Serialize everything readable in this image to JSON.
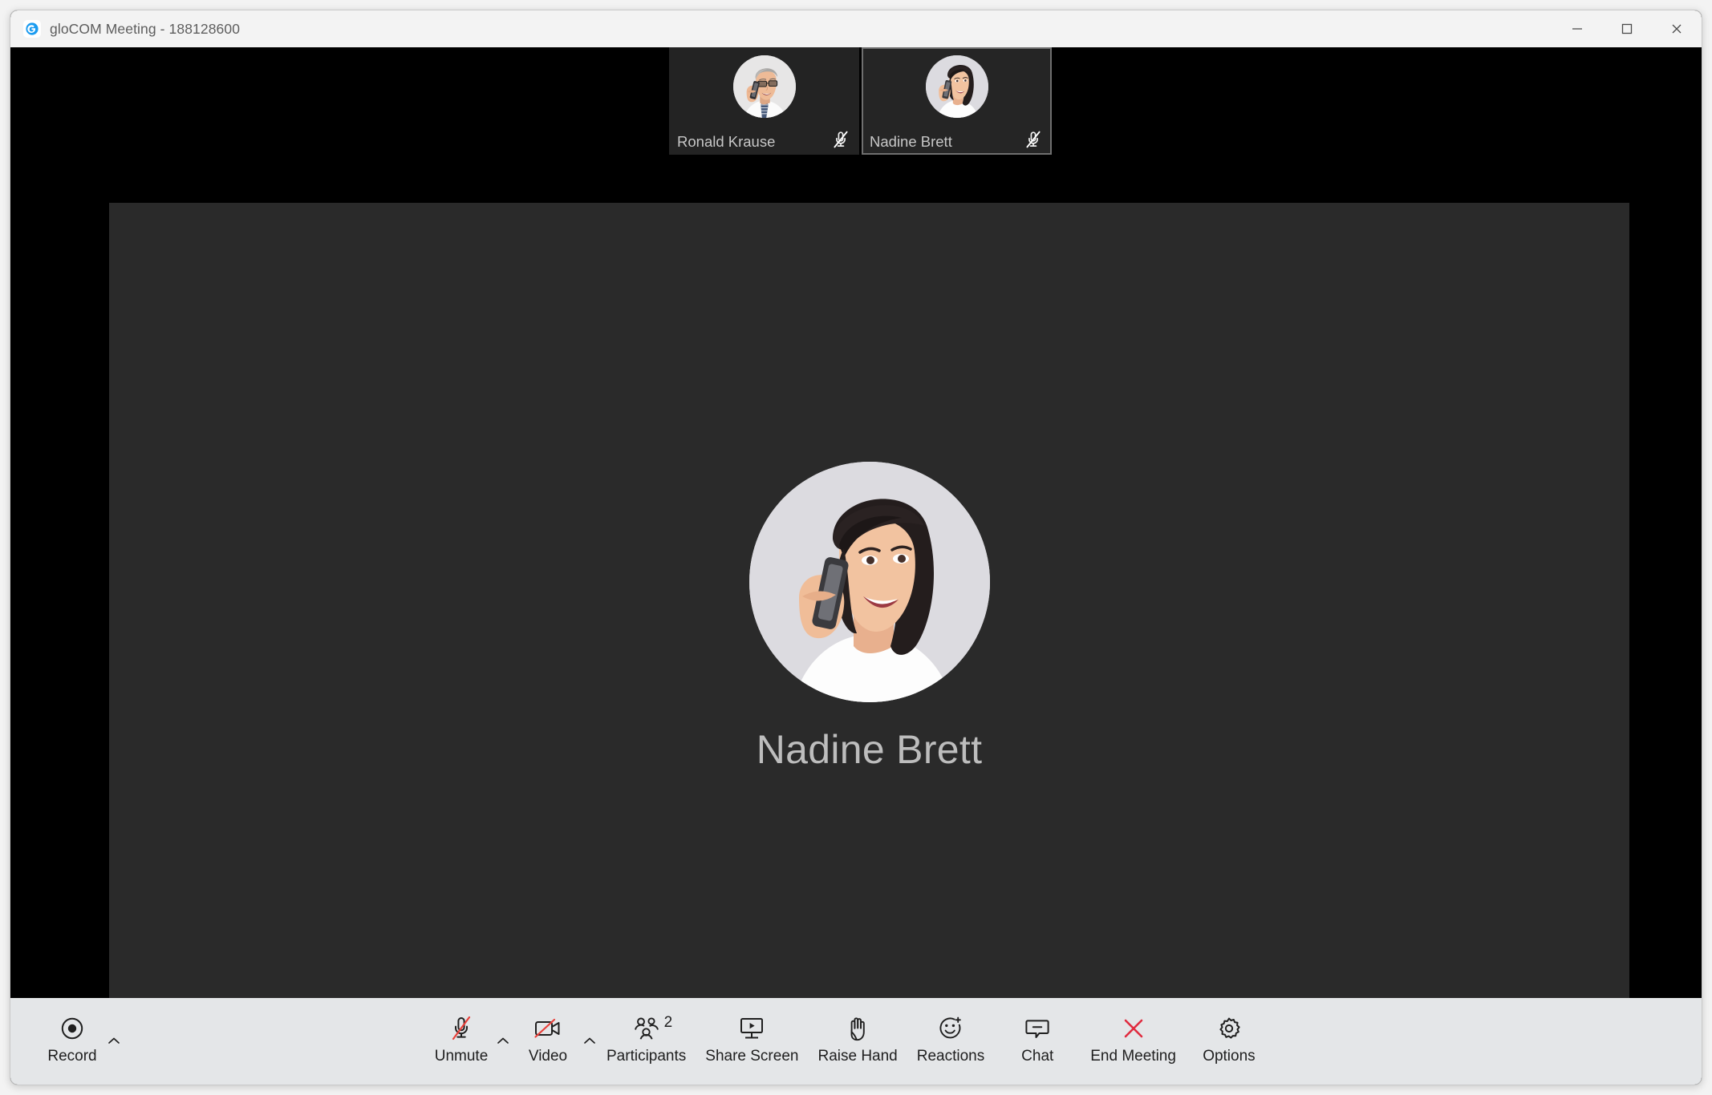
{
  "window": {
    "title": "gloCOM Meeting - 188128600",
    "logo_icon": "glocom-g-icon",
    "controls": {
      "minimize": "minimize-icon",
      "maximize": "maximize-icon",
      "close": "close-icon"
    }
  },
  "colors": {
    "titlebar_bg": "#f3f3f3",
    "canvas_bg": "#000000",
    "stage_bg": "#2a2a2a",
    "thumb_bg": "#232323",
    "toolbar_bg": "#e4e6e8",
    "accent_blue": "#1a9bf0",
    "danger_red": "#e02b3f",
    "mute_slash_red": "#e8403a",
    "name_text": "#bdbdbd"
  },
  "thumbnails": [
    {
      "name": "Ronald Krause",
      "muted": true,
      "active": false,
      "avatar": "man-on-phone-avatar"
    },
    {
      "name": "Nadine Brett",
      "muted": true,
      "active": true,
      "avatar": "woman-on-phone-avatar"
    }
  ],
  "stage": {
    "speaker_name": "Nadine Brett",
    "avatar": "woman-on-phone-avatar",
    "grid_view_icon": "grid-view-icon"
  },
  "toolbar": {
    "left": [
      {
        "id": "record",
        "label": "Record",
        "icon": "record-icon",
        "has_chevron": true
      }
    ],
    "center": [
      {
        "id": "unmute",
        "label": "Unmute",
        "icon": "microphone-muted-icon",
        "has_chevron": true,
        "badge": null
      },
      {
        "id": "video",
        "label": "Video",
        "icon": "camera-off-icon",
        "has_chevron": true,
        "badge": null
      },
      {
        "id": "participants",
        "label": "Participants",
        "icon": "participants-icon",
        "has_chevron": false,
        "badge": "2"
      },
      {
        "id": "share-screen",
        "label": "Share Screen",
        "icon": "share-screen-icon",
        "has_chevron": false,
        "badge": null
      },
      {
        "id": "raise-hand",
        "label": "Raise Hand",
        "icon": "raise-hand-icon",
        "has_chevron": false,
        "badge": null
      },
      {
        "id": "reactions",
        "label": "Reactions",
        "icon": "reactions-icon",
        "has_chevron": false,
        "badge": null
      },
      {
        "id": "chat",
        "label": "Chat",
        "icon": "chat-icon",
        "has_chevron": false,
        "badge": null
      },
      {
        "id": "end-meeting",
        "label": "End Meeting",
        "icon": "end-meeting-x-icon",
        "has_chevron": false,
        "badge": null
      },
      {
        "id": "options",
        "label": "Options",
        "icon": "gear-icon",
        "has_chevron": false,
        "badge": null
      }
    ]
  }
}
